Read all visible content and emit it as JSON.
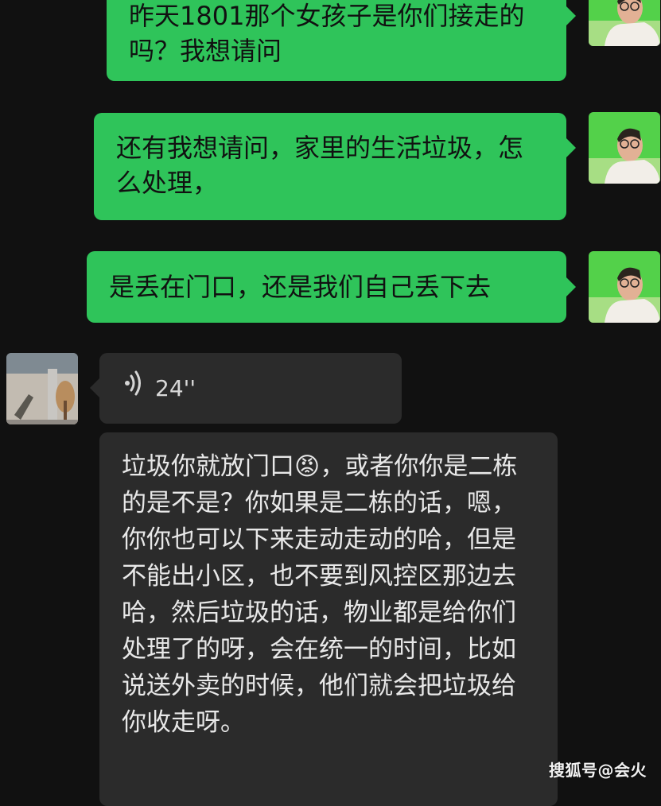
{
  "messages": [
    {
      "side": "outgoing",
      "text": "昨天1801那个女孩子是你们接走的吗？我想请问"
    },
    {
      "side": "outgoing",
      "text": "还有我想请问，家里的生活垃圾，怎么处理，"
    },
    {
      "side": "outgoing",
      "text": "是丢在门口，还是我们自己丢下去"
    },
    {
      "side": "incoming",
      "type": "voice",
      "duration": "24''"
    },
    {
      "side": "incoming",
      "text": "垃圾你就放门口😡，或者你你是二栋的是不是？你如果是二栋的话，嗯，你你也可以下来走动走动的哈，但是不能出小区，也不要到风控区那边去哈，然后垃圾的话，物业都是给你们处理了的呀，会在统一的时间，比如说送外卖的时候，他们就会把垃圾给你收走呀。"
    }
  ],
  "watermark": "搜狐号@会火",
  "colors": {
    "background": "#111111",
    "outgoing_bubble": "#2fc45a",
    "incoming_bubble": "#2b2b2b"
  },
  "icons": {
    "voice": "voice-wave-icon"
  }
}
